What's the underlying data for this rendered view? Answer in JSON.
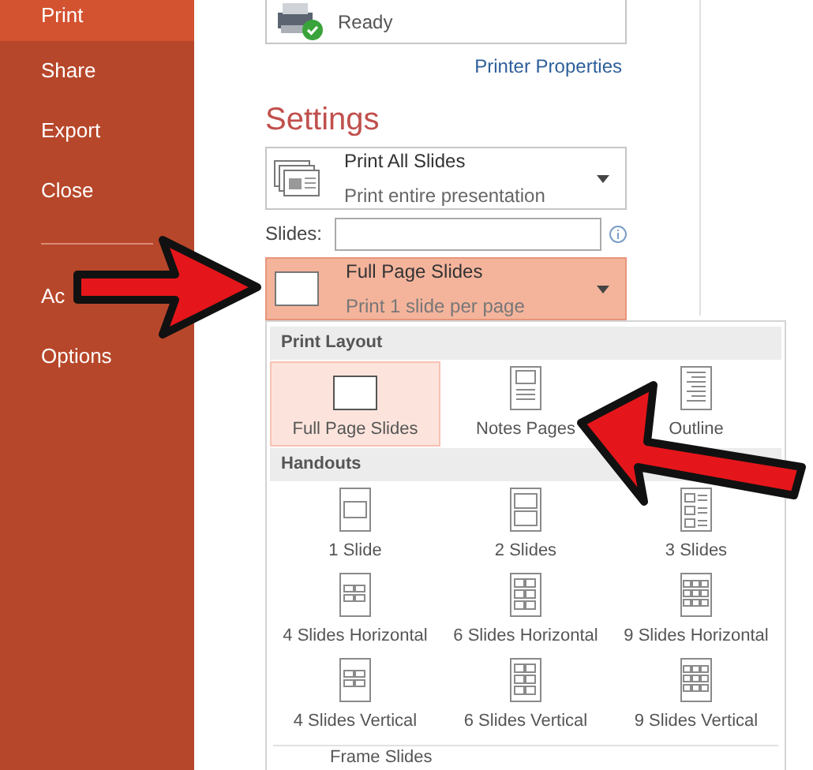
{
  "sidebar": {
    "items": [
      {
        "label": "Print",
        "selected": true
      },
      {
        "label": "Share",
        "selected": false
      },
      {
        "label": "Export",
        "selected": false
      },
      {
        "label": "Close",
        "selected": false
      },
      {
        "kind": "divider"
      },
      {
        "label": "Ac",
        "selected": false
      },
      {
        "label": "Options",
        "selected": false
      }
    ]
  },
  "printer": {
    "status": "Ready",
    "properties_link": "Printer Properties"
  },
  "settings": {
    "heading": "Settings",
    "range": {
      "title": "Print All Slides",
      "subtitle": "Print entire presentation"
    },
    "slides_field": {
      "label": "Slides:"
    },
    "layout": {
      "title": "Full Page Slides",
      "subtitle": "Print 1 slide per page",
      "expanded": true
    }
  },
  "dropdown": {
    "sections": [
      {
        "heading": "Print Layout",
        "items": [
          {
            "label": "Full Page Slides",
            "selected": true
          },
          {
            "label": "Notes Pages",
            "selected": false
          },
          {
            "label": "Outline",
            "selected": false
          }
        ]
      },
      {
        "heading": "Handouts",
        "items": [
          {
            "label": "1 Slide",
            "selected": false
          },
          {
            "label": "2 Slides",
            "selected": false
          },
          {
            "label": "3 Slides",
            "selected": false
          },
          {
            "label": "4 Slides Horizontal",
            "selected": false
          },
          {
            "label": "6 Slides Horizontal",
            "selected": false
          },
          {
            "label": "9 Slides Horizontal",
            "selected": false
          },
          {
            "label": "4 Slides Vertical",
            "selected": false
          },
          {
            "label": "6 Slides Vertical",
            "selected": false
          },
          {
            "label": "9 Slides Vertical",
            "selected": false
          }
        ]
      }
    ],
    "options": [
      {
        "label": "Frame Slides"
      }
    ]
  }
}
